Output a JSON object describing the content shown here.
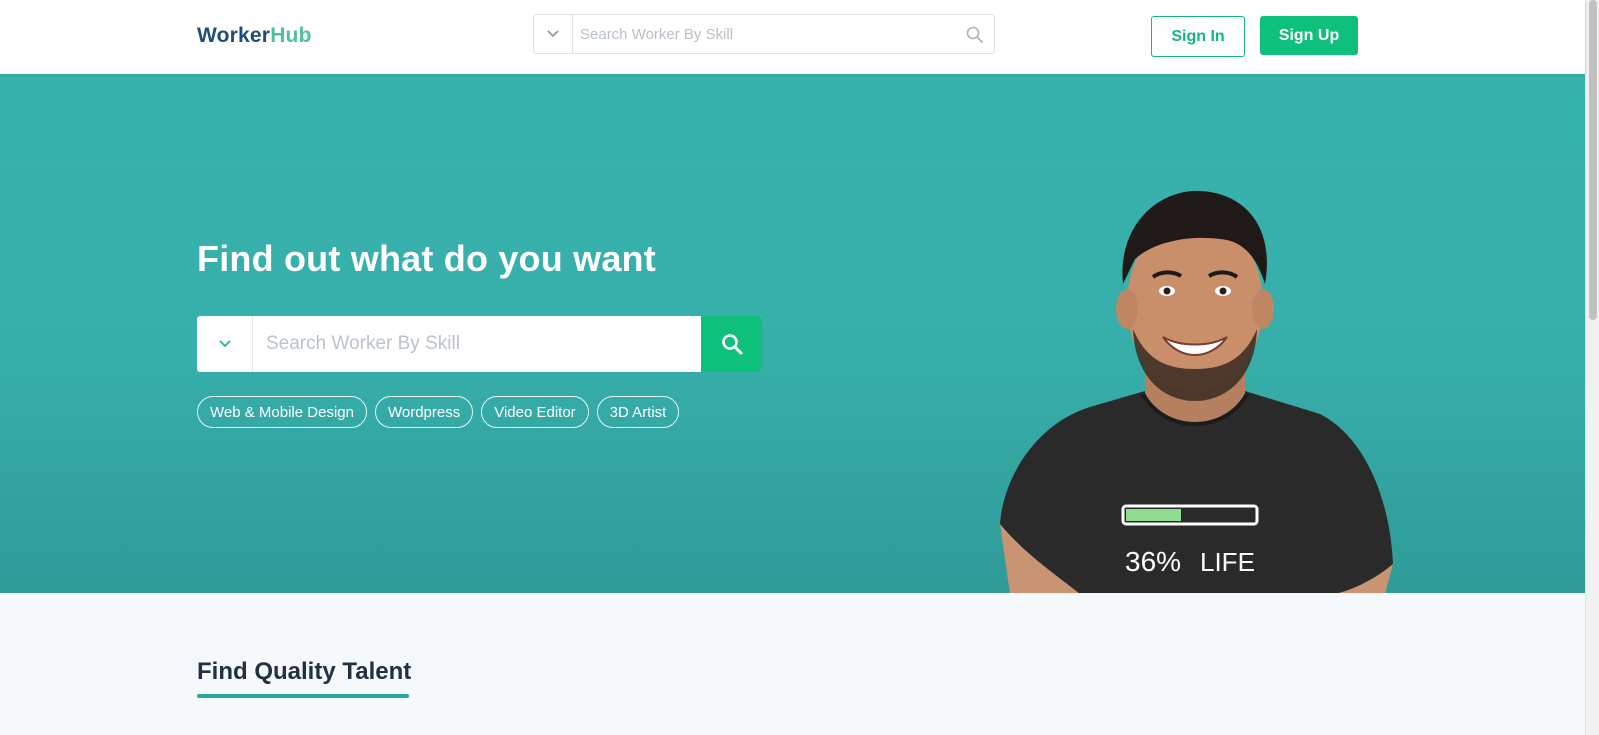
{
  "header": {
    "logo_part1": "Worker",
    "logo_part2": "Hub",
    "search_placeholder": "Search Worker By Skill",
    "sign_in": "Sign In",
    "sign_up": "Sign Up"
  },
  "hero": {
    "title": "Find out what do you want",
    "search_placeholder": "Search Worker By Skill",
    "tags": [
      "Web & Mobile Design",
      "Wordpress",
      "Video Editor",
      "3D Artist"
    ],
    "shirt_text_left": "36%",
    "shirt_text_right": "LIFE"
  },
  "section": {
    "title": "Find Quality Talent"
  },
  "colors": {
    "accent": "#0fbf7c",
    "hero_bg": "#38b3ad",
    "logo_dark": "#1f4e79",
    "logo_light": "#4cc29c"
  },
  "icons": {
    "header_dropdown": "chevron-down-icon",
    "header_search": "search-icon",
    "hero_dropdown": "chevron-down-icon",
    "hero_search": "search-icon"
  }
}
